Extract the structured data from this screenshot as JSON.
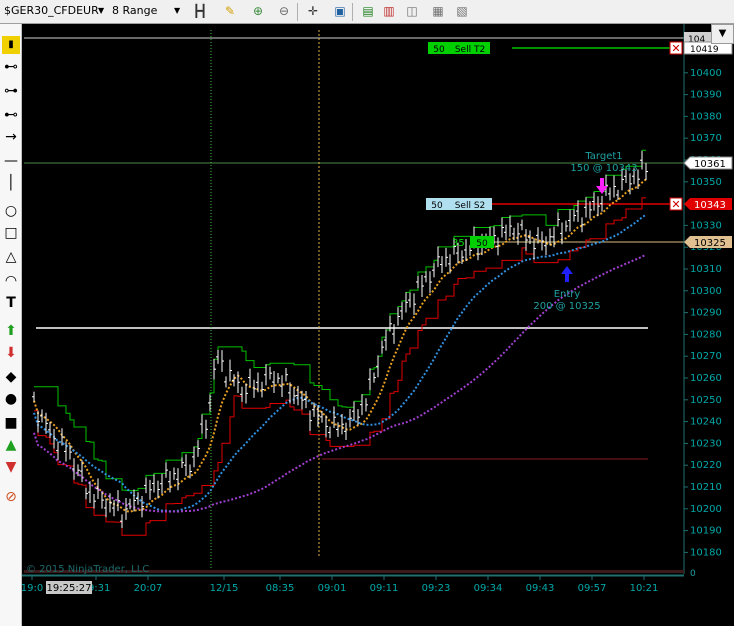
{
  "toolbar": {
    "instrument": "$GER30_CFDEUR",
    "bartype": "8 Range"
  },
  "chart": {
    "copyright": "© 2015 NinjaTrader, LLC",
    "cursor_time": "19:25:27",
    "time_labels": [
      "19:0",
      "19:31",
      "20:07",
      "12/15",
      "08:35",
      "09:01",
      "09:11",
      "09:23",
      "09:34",
      "09:43",
      "09:57",
      "10:21"
    ],
    "price_labels": [
      "10410",
      "10400",
      "10390",
      "10380",
      "10370",
      "10360",
      "10350",
      "10340",
      "10330",
      "10320",
      "10310",
      "10300",
      "10290",
      "10280",
      "10270",
      "10260",
      "10250",
      "10240",
      "10230",
      "10220",
      "10210",
      "10200",
      "10190",
      "10180"
    ],
    "price_tags": {
      "top": "104",
      "t2": "10419",
      "last": "10361",
      "stop": "10343",
      "entry_level": "10325",
      "zero": "0"
    },
    "orders": {
      "sell_t2_qty": "50",
      "sell_t2_label": "Sell T2",
      "sell_s2_qty": "50",
      "sell_s2_label": "Sell S2",
      "buy_qty_left": "35",
      "buy_qty": "50"
    },
    "annotations": {
      "target_title": "Target1",
      "target_detail": "150 @ 10343",
      "entry_title": "Entry",
      "entry_detail": "200 @ 10325"
    },
    "colors": {
      "background": "#000000",
      "upper_channel": "#00c000",
      "lower_channel": "#e00000",
      "ma_fast": "#e8a020",
      "ma_mid": "#3090e0",
      "ma_slow": "#a040d0",
      "axis_text": "#00a8a8"
    }
  }
}
